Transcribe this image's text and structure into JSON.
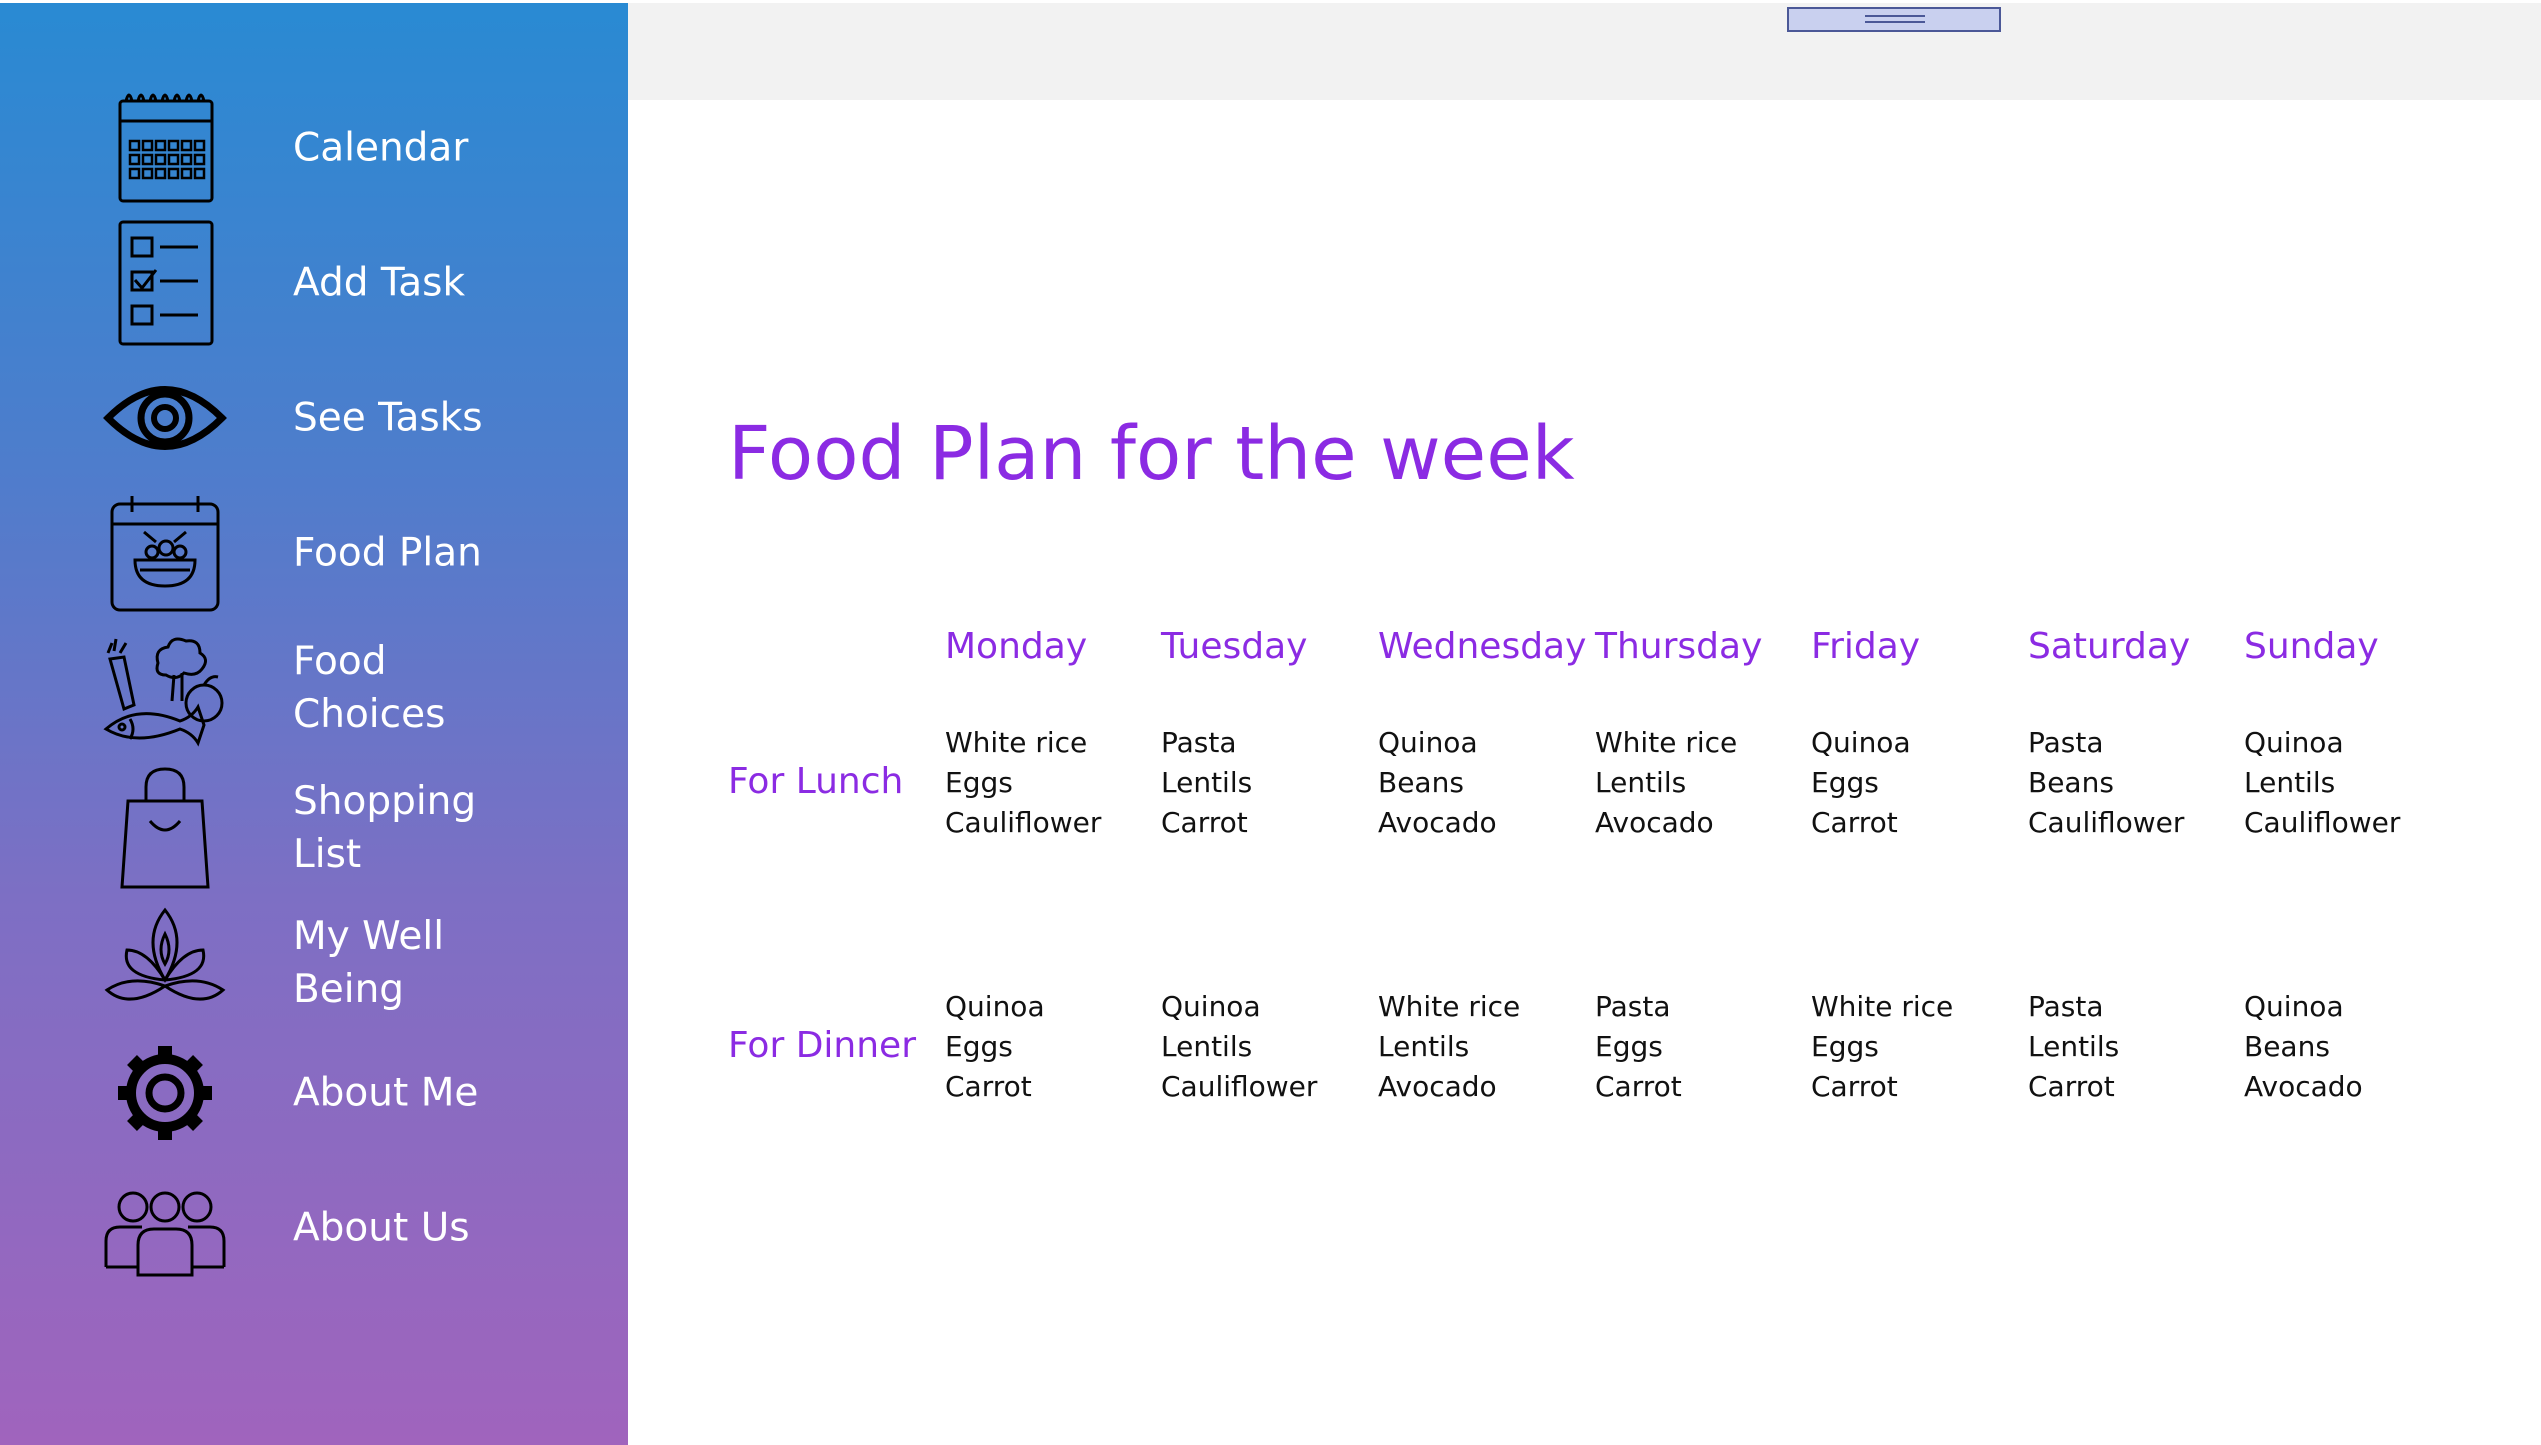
{
  "sidebar": {
    "items": [
      {
        "label": "Calendar",
        "icon": "calendar-icon"
      },
      {
        "label": "Add Task",
        "icon": "checklist-icon"
      },
      {
        "label": "See Tasks",
        "icon": "eye-icon"
      },
      {
        "label": "Food Plan",
        "icon": "food-bowl-calendar-icon"
      },
      {
        "label": "Food\nChoices",
        "icon": "vegetables-fish-icon"
      },
      {
        "label": "Shopping\nList",
        "icon": "shopping-bag-icon"
      },
      {
        "label": "My Well\nBeing",
        "icon": "lotus-icon"
      },
      {
        "label": "About Me",
        "icon": "gear-icon"
      },
      {
        "label": "About Us",
        "icon": "people-group-icon"
      }
    ],
    "gradient_top": "#298ad3",
    "gradient_bottom": "#a064bd"
  },
  "topbar": {
    "handle_icon": "pane-drag-handle-icon"
  },
  "main": {
    "title": "Food Plan for the week",
    "accent_color": "#8b2be3",
    "days": [
      "Monday",
      "Tuesday",
      "Wednesday",
      "Thursday",
      "Friday",
      "Saturday",
      "Sunday"
    ],
    "meals": [
      {
        "label": "For Lunch",
        "items": [
          [
            "White rice",
            "Eggs",
            "Cauliflower"
          ],
          [
            "Pasta",
            "Lentils",
            "Carrot"
          ],
          [
            "Quinoa",
            "Beans",
            "Avocado"
          ],
          [
            "White rice",
            "Lentils",
            "Avocado"
          ],
          [
            "Quinoa",
            "Eggs",
            "Carrot"
          ],
          [
            "Pasta",
            "Beans",
            "Cauliflower"
          ],
          [
            "Quinoa",
            "Lentils",
            "Cauliflower"
          ]
        ]
      },
      {
        "label": "For Dinner",
        "items": [
          [
            "Quinoa",
            "Eggs",
            "Carrot"
          ],
          [
            "Quinoa",
            "Lentils",
            "Cauliflower"
          ],
          [
            "White rice",
            "Lentils",
            "Avocado"
          ],
          [
            "Pasta",
            "Eggs",
            "Carrot"
          ],
          [
            "White rice",
            "Eggs",
            "Carrot"
          ],
          [
            "Pasta",
            "Lentils",
            "Carrot"
          ],
          [
            "Quinoa",
            "Beans",
            "Avocado"
          ]
        ]
      }
    ]
  }
}
